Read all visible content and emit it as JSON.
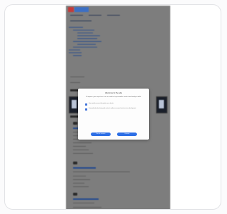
{
  "dialog": {
    "title": "Welcome to the site",
    "body": "To improve your experience, we use cookies to personalize content and analyze traffic",
    "options": [
      {
        "label": "Store and/or access information on a device"
      },
      {
        "label": "Personalised advertising and content, audience research and services development"
      }
    ],
    "decline_label": "Do not consent",
    "accept_label": "Consent"
  },
  "colors": {
    "backdrop": "#7d7d7d",
    "dialog_bg": "#fdfdfd",
    "button": "#2d6fe6",
    "link": "#234a8f"
  },
  "icons": [
    "logo",
    "poster-thumbnail",
    "entry-icon",
    "checkbox-icon"
  ]
}
